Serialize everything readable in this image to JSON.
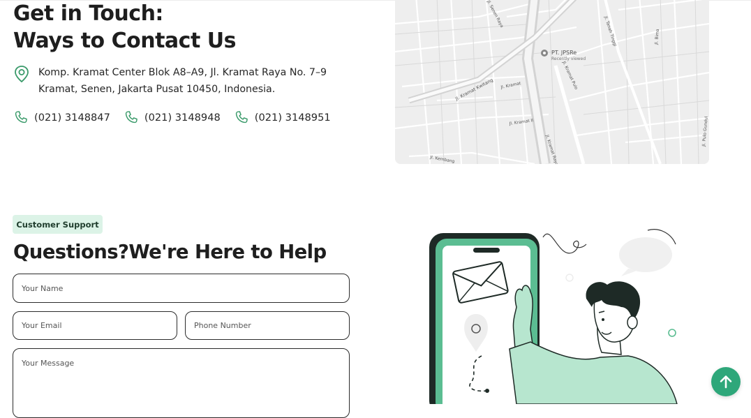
{
  "contact": {
    "title_line1": "Get in Touch:",
    "title_line2": "Ways to Contact Us",
    "address_line1": "Komp. Kramat Center Blok A8–A9, Jl. Kramat Raya No. 7–9",
    "address_line2": "Kramat, Senen, Jakarta Pusat 10450, Indonesia.",
    "phones": [
      "(021) 3148847",
      "(021) 3148948",
      "(021) 3148951"
    ]
  },
  "map": {
    "place_name": "PT. JPSRe",
    "place_sub": "Recently viewed",
    "streets": [
      "Jl. Kramat Kwitang",
      "Jl. Kramat",
      "Jl. Kramat II",
      "Jl. Kramat Raya",
      "Jl. Kramat Pulo",
      "Jl. Tanah Tinggi",
      "Jl. Bima",
      "Jl. Pulo Gundul",
      "Jl. Senen Raya",
      "Jl. Kembang"
    ]
  },
  "support": {
    "badge": "Customer Support",
    "heading": "Questions?We're Here to Help",
    "name_placeholder": "Your Name",
    "email_placeholder": "Your Email",
    "phone_placeholder": "Phone Number",
    "message_placeholder": "Your Message"
  },
  "colors": {
    "accent": "#2ea77a",
    "icon_green": "#3a9a6a",
    "badge_bg": "#dcf3e7",
    "illustration_green": "#5bbd92"
  },
  "icons": {
    "location": "location-pin-icon",
    "phone": "phone-icon",
    "scroll_top": "arrow-up-icon"
  }
}
